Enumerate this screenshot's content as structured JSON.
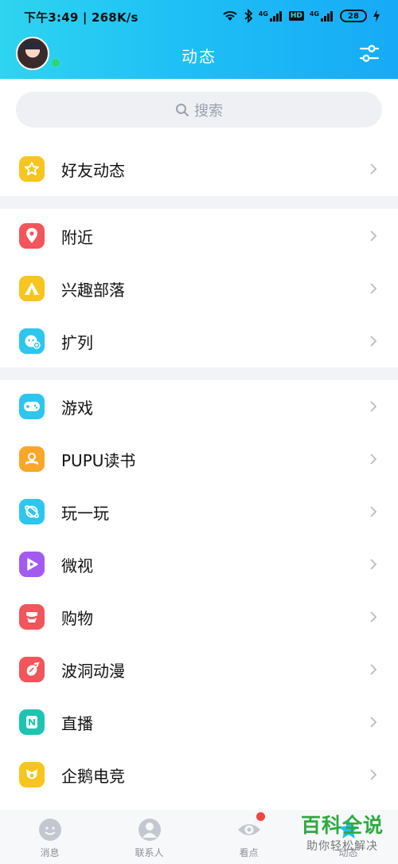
{
  "status_bar": {
    "time_speed": "下午3:49 | 268K/s",
    "network_1": "4G",
    "network_2": "4G",
    "hd": "HD",
    "battery": "28"
  },
  "header": {
    "title": "动态",
    "avatar_online": true
  },
  "search": {
    "placeholder": "搜索"
  },
  "sections": [
    {
      "items": [
        {
          "label": "好友动态",
          "icon": "star-icon",
          "color": "#f7c51e"
        }
      ]
    },
    {
      "items": [
        {
          "label": "附近",
          "icon": "location-pin-icon",
          "color": "#f2555a"
        },
        {
          "label": "兴趣部落",
          "icon": "tent-icon",
          "color": "#f7c51e"
        },
        {
          "label": "扩列",
          "icon": "face-plus-icon",
          "color": "#2cc6ee"
        }
      ]
    },
    {
      "items": [
        {
          "label": "游戏",
          "icon": "gamepad-icon",
          "color": "#2cc6ee"
        },
        {
          "label": "PUPU读书",
          "icon": "book-reader-icon",
          "color": "#f8a72a"
        },
        {
          "label": "玩一玩",
          "icon": "planet-icon",
          "color": "#2cc6ee"
        },
        {
          "label": "微视",
          "icon": "play-icon",
          "color": "#a35af0"
        },
        {
          "label": "购物",
          "icon": "shopping-icon",
          "color": "#f2555a"
        },
        {
          "label": "波洞动漫",
          "icon": "comic-icon",
          "color": "#f2555a"
        },
        {
          "label": "直播",
          "icon": "live-icon",
          "color": "#1dc4b2"
        },
        {
          "label": "企鹅电竞",
          "icon": "esports-icon",
          "color": "#f7c51e"
        }
      ]
    }
  ],
  "bottom_nav": [
    {
      "label": "消息",
      "icon": "message-icon"
    },
    {
      "label": "联系人",
      "icon": "contacts-icon"
    },
    {
      "label": "看点",
      "icon": "eye-icon",
      "has_badge": true
    },
    {
      "label": "动态",
      "icon": "star-tab-icon"
    }
  ],
  "watermark": {
    "line1": "百科全说",
    "line2": "助你轻松解决"
  }
}
